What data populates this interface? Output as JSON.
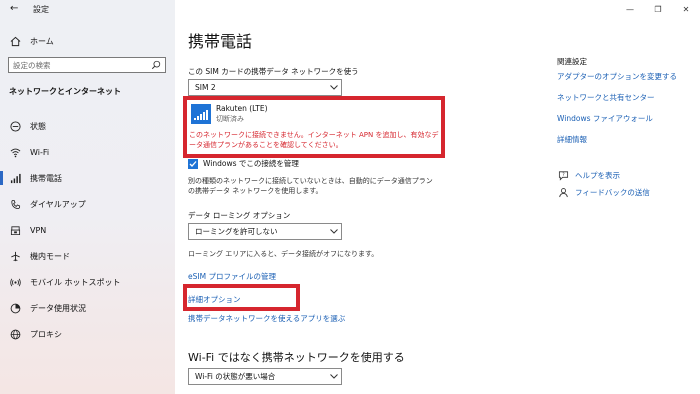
{
  "window": {
    "title": "設定",
    "controls": [
      "—",
      "❐",
      "✕"
    ]
  },
  "sidebar": {
    "home_label": "ホーム",
    "search_placeholder": "設定の検索",
    "section_title": "ネットワークとインターネット",
    "items": [
      {
        "label": "状態",
        "icon": "status-icon"
      },
      {
        "label": "Wi-Fi",
        "icon": "wifi-icon"
      },
      {
        "label": "携帯電話",
        "icon": "cellular-icon",
        "active": true
      },
      {
        "label": "ダイヤルアップ",
        "icon": "dialup-icon"
      },
      {
        "label": "VPN",
        "icon": "vpn-icon"
      },
      {
        "label": "機内モード",
        "icon": "airplane-icon"
      },
      {
        "label": "モバイル ホットスポット",
        "icon": "hotspot-icon"
      },
      {
        "label": "データ使用状況",
        "icon": "data-usage-icon"
      },
      {
        "label": "プロキシ",
        "icon": "proxy-icon"
      }
    ]
  },
  "main": {
    "title": "携帯電話",
    "sim_label": "この SIM カードの携帯データ ネットワークを使う",
    "sim_value": "SIM 2",
    "network": {
      "name": "Rakuten (LTE)",
      "status": "切断済み",
      "error": "このネットワークに接続できません。インターネット APN を追加し、有効なデータ通信プランがあることを確認してください。"
    },
    "checkbox_label": "Windows でこの接続を管理",
    "auto_desc": "別の種類のネットワークに接続していないときは、自動的にデータ通信プランの携帯データ ネットワークを使用します。",
    "roaming_label": "データ ローミング オプション",
    "roaming_value": "ローミングを許可しない",
    "roaming_desc": "ローミング エリアに入ると、データ接続がオフになります。",
    "esim_link": "eSIM プロファイルの管理",
    "advanced_link": "詳細オプション",
    "apps_link": "携帯データネットワークを使えるアプリを選ぶ",
    "section2_title": "Wi-Fi ではなく携帯ネットワークを使用する",
    "wifi_pref_value": "Wi-Fi の状態が悪い場合"
  },
  "related": {
    "title": "関連設定",
    "links": [
      "アダプターのオプションを変更する",
      "ネットワークと共有センター",
      "Windows ファイアウォール",
      "詳細情報"
    ],
    "help_label": "ヘルプを表示",
    "feedback_label": "フィードバックの送信"
  },
  "colors": {
    "accent": "#1e73d6",
    "link": "#1a5fb4",
    "highlight": "#d6262e",
    "error_text": "#d6262e"
  }
}
